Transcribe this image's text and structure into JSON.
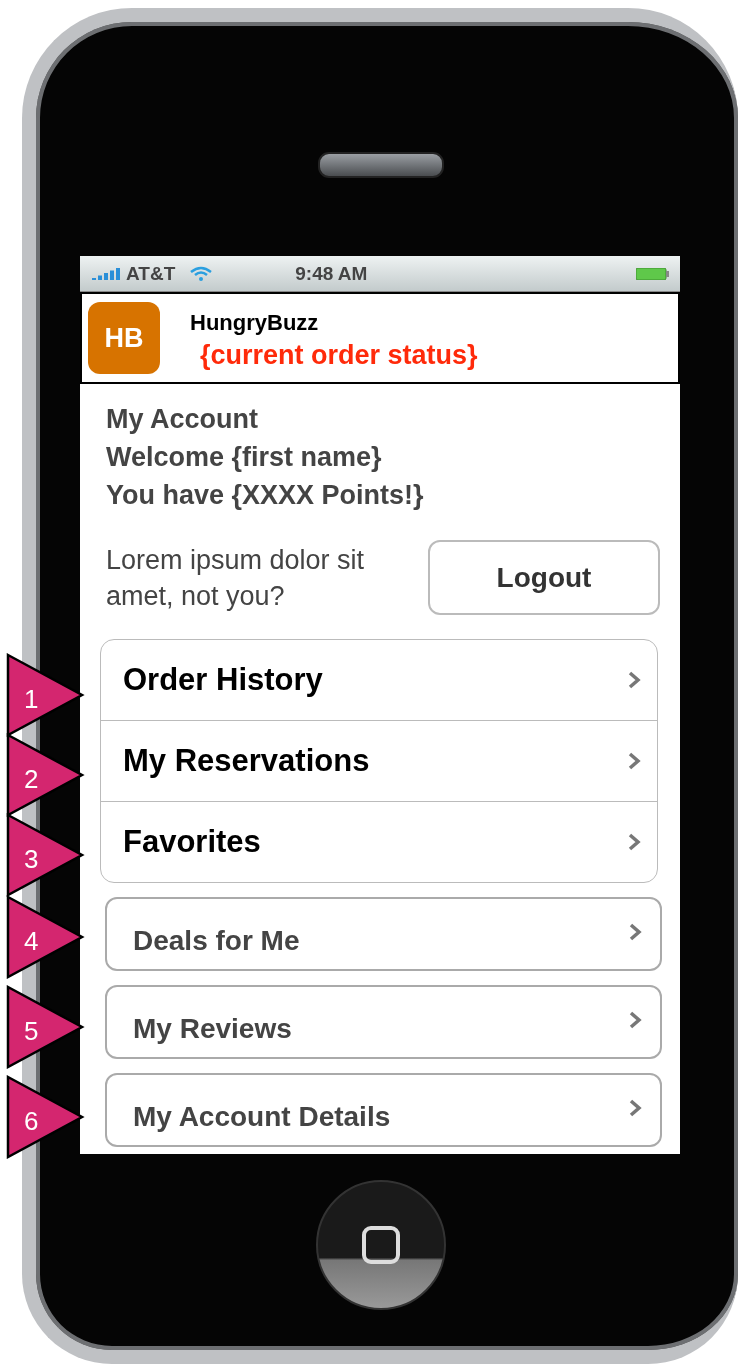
{
  "status_bar": {
    "carrier": "AT&T",
    "time": "9:48 AM"
  },
  "header": {
    "logo": "HB",
    "app_name": "HungryBuzz",
    "order_status": "{current order status}"
  },
  "account": {
    "title": "My Account",
    "welcome": "Welcome {first name}",
    "points": "You have {XXXX Points!}"
  },
  "note": "Lorem ipsum dolor sit amet, not you?",
  "logout_button": "Logout",
  "menu": [
    {
      "label": "Order History",
      "kind": "grouped"
    },
    {
      "label": "My Reservations",
      "kind": "grouped"
    },
    {
      "label": "Favorites",
      "kind": "grouped"
    },
    {
      "label": "Deals for Me",
      "kind": "single"
    },
    {
      "label": "My Reviews",
      "kind": "single"
    },
    {
      "label": "My Account Details",
      "kind": "single"
    }
  ],
  "callouts": [
    "1",
    "2",
    "3",
    "4",
    "5",
    "6"
  ]
}
